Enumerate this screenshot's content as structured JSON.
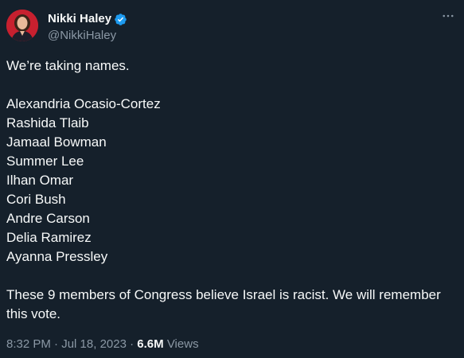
{
  "author": {
    "display_name": "Nikki Haley",
    "handle": "@NikkiHaley",
    "verified_color": "#1d9bf0"
  },
  "tweet": {
    "intro": "We’re taking names.",
    "names": [
      "Alexandria Ocasio-Cortez",
      "Rashida Tlaib",
      "Jamaal Bowman",
      "Summer Lee",
      "Ilhan Omar",
      "Cori Bush",
      "Andre Carson",
      "Delia Ramirez",
      "Ayanna Pressley"
    ],
    "closing": "These 9 members of Congress believe Israel is racist. We will remember this vote."
  },
  "meta": {
    "time": "8:32 PM",
    "separator": "·",
    "date": "Jul 18, 2023",
    "views_count": "6.6M",
    "views_label": "Views"
  },
  "icons": {
    "verified": "verified-badge-icon",
    "more": "more-icon"
  },
  "colors": {
    "background": "#15202b",
    "text": "#f7f9f9",
    "secondary": "#8b98a5"
  }
}
